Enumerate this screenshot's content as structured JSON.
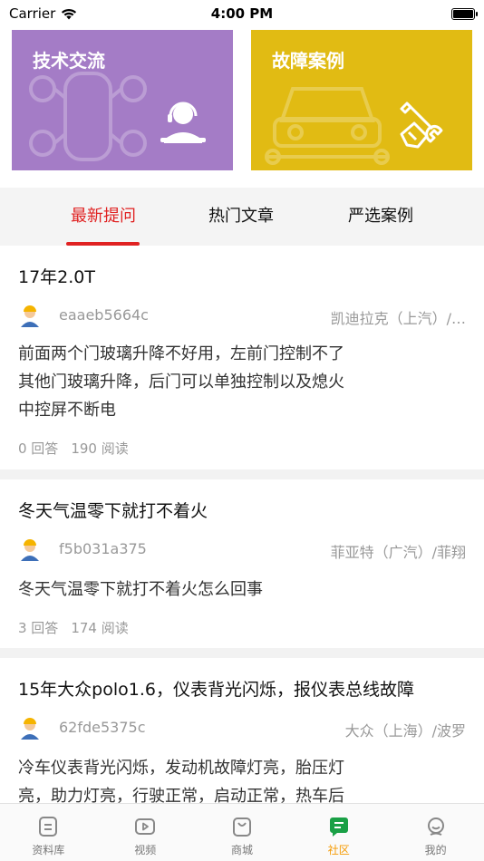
{
  "status_bar": {
    "carrier": "Carrier",
    "time": "4:00 PM"
  },
  "cards": [
    {
      "title": "技术交流",
      "icon": "technician-headset-icon",
      "color": "#a47cc6"
    },
    {
      "title": "故障案例",
      "icon": "wrench-hand-icon",
      "color": "#e1bb13"
    }
  ],
  "tabs": [
    {
      "label": "最新提问",
      "active": true
    },
    {
      "label": "热门文章",
      "active": false
    },
    {
      "label": "严选案例",
      "active": false
    }
  ],
  "posts": [
    {
      "title": "17年2.0T",
      "author": "eaaeb5664c",
      "car": "凯迪拉克（上汽）/…",
      "body": [
        "前面两个门玻璃升降不好用，左前门控制不了",
        "其他门玻璃升降，后门可以单独控制以及熄火",
        "中控屏不断电"
      ],
      "answers": "0 回答",
      "reads": "190 阅读"
    },
    {
      "title": "冬天气温零下就打不着火",
      "author": "f5b031a375",
      "car": "菲亚特（广汽）/菲翔",
      "body": [
        "冬天气温零下就打不着火怎么回事"
      ],
      "answers": "3 回答",
      "reads": "174 阅读"
    },
    {
      "title": "15年大众polo1.6，仪表背光闪烁，报仪表总线故障",
      "author": "62fde5375c",
      "car": "大众（上海）/波罗",
      "body": [
        "冷车仪表背光闪烁，发动机故障灯亮，胎压灯",
        "亮，助力灯亮，行驶正常，启动正常，热车后"
      ]
    }
  ],
  "tabbar": [
    {
      "label": "资料库",
      "icon": "document-icon",
      "active": false
    },
    {
      "label": "视频",
      "icon": "video-icon",
      "active": false
    },
    {
      "label": "商城",
      "icon": "shopping-bag-icon",
      "active": false
    },
    {
      "label": "社区",
      "icon": "chat-icon",
      "active": true
    },
    {
      "label": "我的",
      "icon": "profile-icon",
      "active": false
    }
  ],
  "colors": {
    "accent_red": "#e02222",
    "accent_orange": "#f59a00"
  }
}
